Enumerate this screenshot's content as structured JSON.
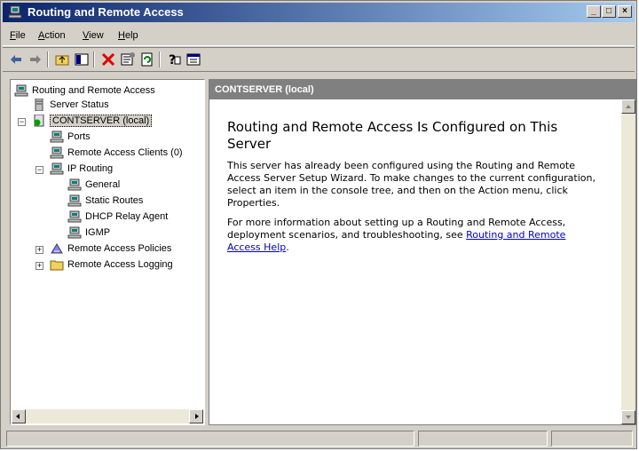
{
  "window": {
    "title": "Routing and Remote Access"
  },
  "menu": [
    {
      "label": "File",
      "mnemonic": "F",
      "rest": "ile"
    },
    {
      "label": "Action",
      "mnemonic": "A",
      "rest": "ction"
    },
    {
      "label": "View",
      "mnemonic": "V",
      "rest": "iew"
    },
    {
      "label": "Help",
      "mnemonic": "H",
      "rest": "elp"
    }
  ],
  "toolbar": {
    "icons": [
      "back-icon",
      "forward-icon",
      "up-folder-icon",
      "show-hide-tree-icon",
      "delete-icon",
      "properties-icon",
      "refresh-icon",
      "help-icon",
      "console-icon"
    ]
  },
  "tree": {
    "root": "Routing and Remote Access",
    "server_status": "Server Status",
    "server": "CONTSERVER (local)",
    "ports": "Ports",
    "clients": "Remote Access Clients (0)",
    "ip_routing": "IP Routing",
    "general": "General",
    "static_routes": "Static Routes",
    "dhcp_relay": "DHCP Relay Agent",
    "igmp": "IGMP",
    "policies": "Remote Access Policies",
    "logging": "Remote Access Logging"
  },
  "result": {
    "header": "CONTSERVER (local)",
    "heading": "Routing and Remote Access Is Configured on This Server",
    "p1": "This server has already been configured using the Routing and Remote Access Server Setup Wizard. To make changes to the current configuration, select an item in the console tree, and then on the Action menu, click Properties.",
    "p2_prefix": "For more information about setting up a Routing and Remote Access, deployment scenarios, and troubleshooting, see ",
    "p2_link": "Routing and Remote Access Help",
    "p2_suffix": "."
  },
  "colors": {
    "title_start": "#0a246a",
    "title_end": "#a6caf0",
    "face": "#d4d0c8",
    "header": "#808080",
    "link": "#0000cc"
  }
}
